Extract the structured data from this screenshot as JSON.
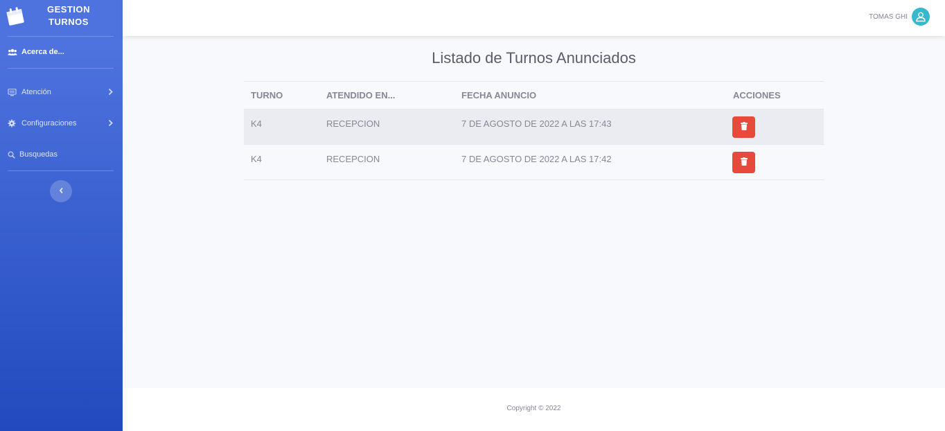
{
  "brand": {
    "line1": "GESTION",
    "line2": "TURNOS",
    "icon": "calendar-icon"
  },
  "sidebar": {
    "items": [
      {
        "label": "Acerca de...",
        "icon": "users-icon",
        "active": true
      },
      {
        "label": "Atención",
        "icon": "desktop-icon",
        "has_submenu": true
      },
      {
        "label": "Configuraciones",
        "icon": "gear-icon",
        "has_submenu": true
      },
      {
        "label": "Busquedas",
        "icon": "search-icon"
      }
    ]
  },
  "topbar": {
    "user_name": "TOMAS GHI",
    "avatar_icon": "user-icon"
  },
  "main": {
    "title": "Listado de Turnos Anunciados",
    "table": {
      "headers": [
        "TURNO",
        "ATENDIDO EN...",
        "FECHA ANUNCIO",
        "ACCIONES"
      ],
      "rows": [
        {
          "turno": "K4",
          "atendido_en": "RECEPCION",
          "fecha": "7 DE AGOSTO DE 2022 A LAS 17:43",
          "action_icon": "trash-icon"
        },
        {
          "turno": "K4",
          "atendido_en": "RECEPCION",
          "fecha": "7 DE AGOSTO DE 2022 A LAS 17:42",
          "action_icon": "trash-icon"
        }
      ]
    }
  },
  "footer": {
    "copyright": "Copyright © 2022"
  },
  "colors": {
    "sidebar_top": "#4e73df",
    "sidebar_bottom": "#224abe",
    "danger": "#e74a3b",
    "avatar": "#36b9cc"
  }
}
